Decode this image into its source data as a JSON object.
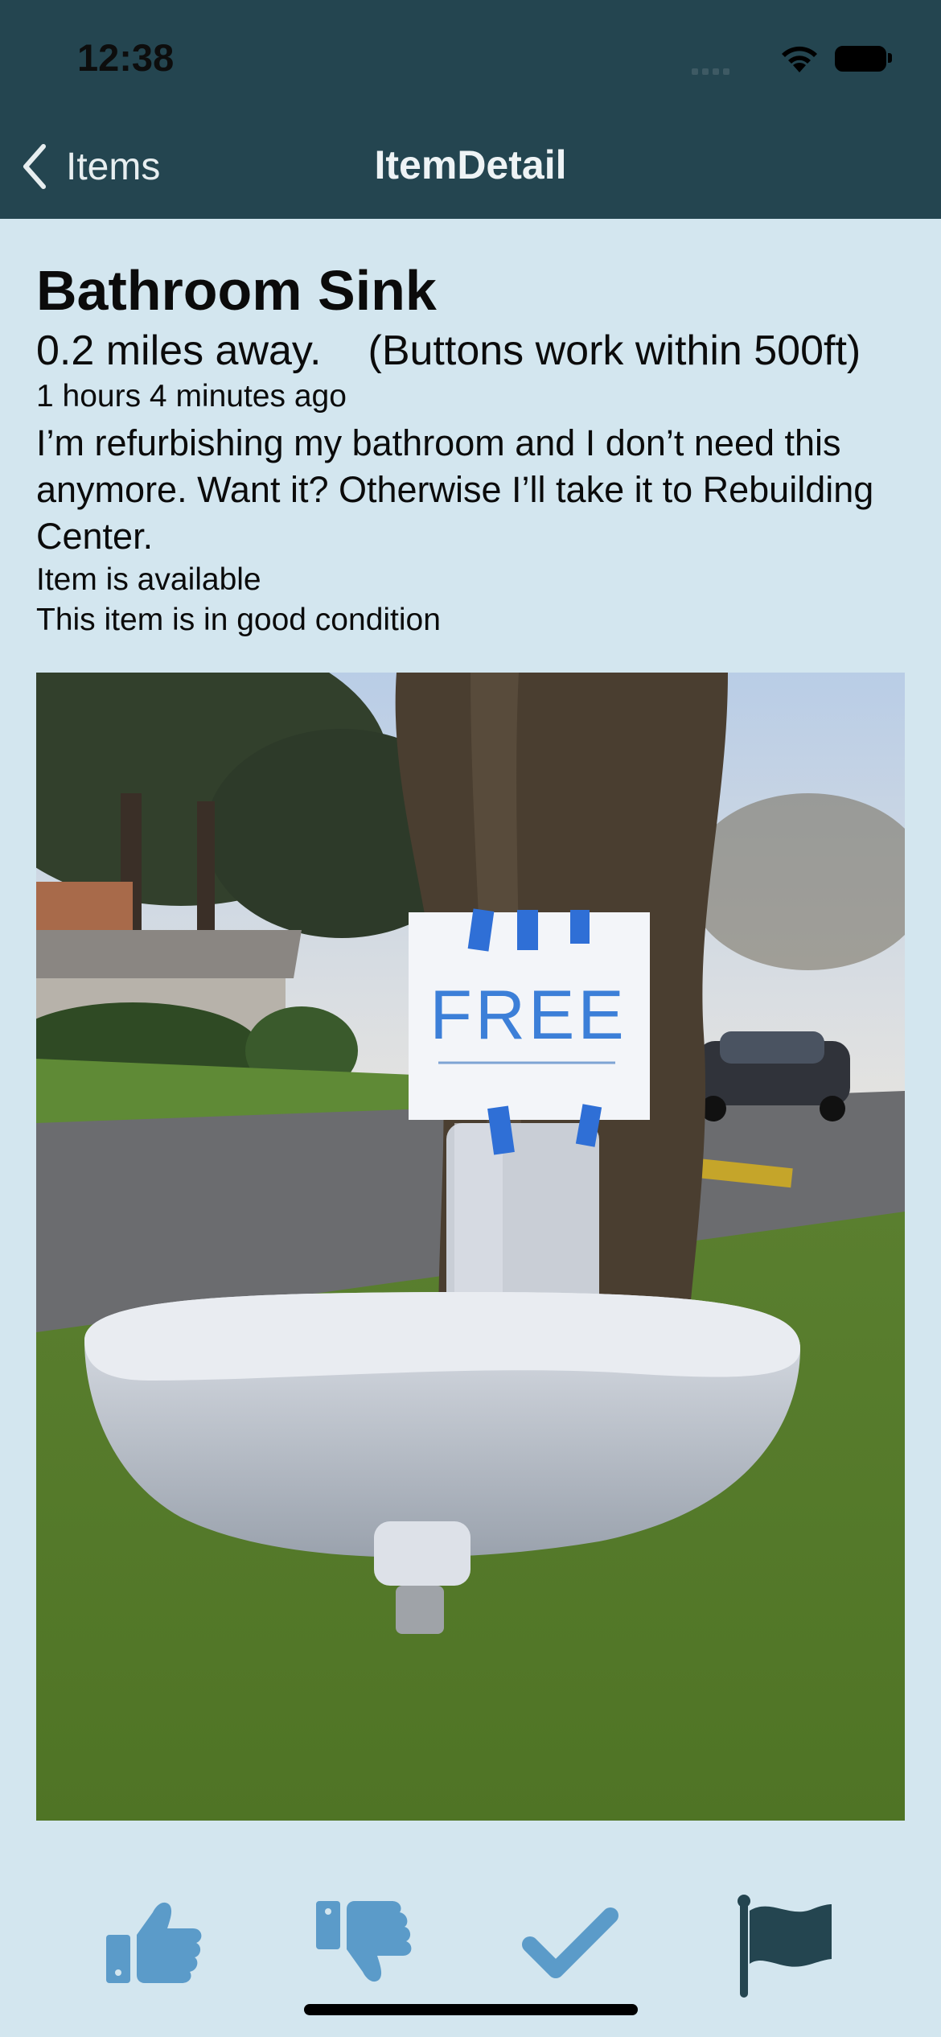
{
  "status_bar": {
    "time": "12:38"
  },
  "nav": {
    "back_label": "Items",
    "title": "ItemDetail"
  },
  "item": {
    "title": "Bathroom Sink",
    "distance": "0.2 miles away.",
    "buttons_note": "(Buttons work within 500ft)",
    "posted": "1 hours 4 minutes ago",
    "description": "I’m refurbishing my bathroom and I don’t need this anymore. Want it? Otherwise I’ll take it to Rebuilding Center.",
    "availability": "Item is available",
    "condition": "This item is in good condition",
    "photo_sign_text": "FREE"
  },
  "actions": [
    {
      "icon": "thumbs-up-icon"
    },
    {
      "icon": "thumbs-down-icon"
    },
    {
      "icon": "checkmark-icon"
    },
    {
      "icon": "flag-icon"
    }
  ],
  "colors": {
    "header": "#244550",
    "background": "#d3e6ef",
    "icon_blue": "#5b9bc9",
    "flag": "#244550"
  }
}
